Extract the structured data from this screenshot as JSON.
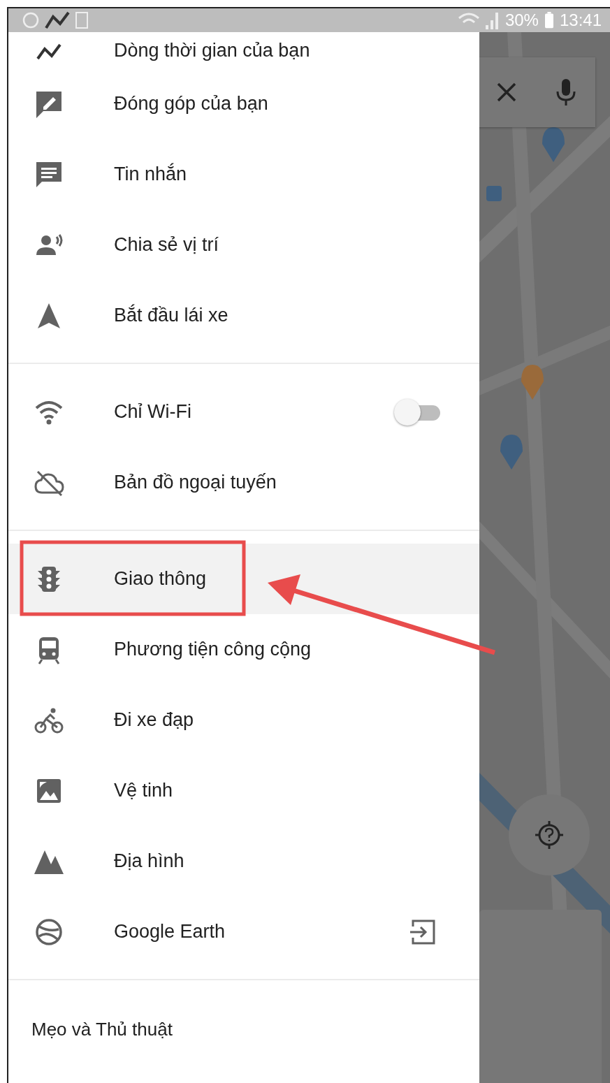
{
  "status_bar": {
    "battery": "30%",
    "time": "13:41"
  },
  "menu": {
    "sections": [
      {
        "items": [
          {
            "kind": "link",
            "label": "Dòng thời gian của bạn"
          },
          {
            "kind": "link",
            "label": "Đóng góp của bạn"
          },
          {
            "kind": "link",
            "label": "Tin nhắn"
          },
          {
            "kind": "link",
            "label": "Chia sẻ vị trí"
          },
          {
            "kind": "link",
            "label": "Bắt đầu lái xe"
          }
        ]
      },
      {
        "items": [
          {
            "kind": "toggle",
            "label": "Chỉ Wi-Fi",
            "on": false
          },
          {
            "kind": "link",
            "label": "Bản đồ ngoại tuyến"
          }
        ]
      },
      {
        "items": [
          {
            "kind": "layer",
            "label": "Giao thông",
            "selected": true
          },
          {
            "kind": "layer",
            "label": "Phương tiện công cộng",
            "selected": false
          },
          {
            "kind": "layer",
            "label": "Đi xe đạp",
            "selected": false
          },
          {
            "kind": "layer",
            "label": "Vệ tinh",
            "selected": false
          },
          {
            "kind": "layer",
            "label": "Địa hình",
            "selected": false
          },
          {
            "kind": "external",
            "label": "Google Earth"
          }
        ]
      }
    ],
    "footer": {
      "label": "Mẹo và Thủ thuật"
    }
  }
}
